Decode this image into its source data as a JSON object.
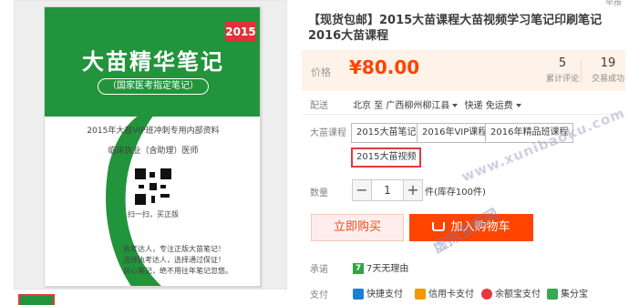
{
  "header": {
    "report_link": "举报"
  },
  "product": {
    "title": "【现货包邮】2015大苗课程大苗视频学习笔记印刷笔记2016大苗课程",
    "cover": {
      "year": "2015",
      "title": "大苗精华笔记",
      "subtitle": "（国家医考指定笔记）",
      "line1": "2015年大苗VIP班冲刺专用内部资料",
      "line2": "临床执业（含助理）医师",
      "scan_text": "扫一扫，买正版",
      "slogans": [
        "执考达人，专注正版大苗笔记！",
        "选择执考达人，选择通过保证！",
        "良心笔记，绝不用往年笔记忽悠。"
      ]
    }
  },
  "price": {
    "label": "价格",
    "value": "¥80.00"
  },
  "stats": [
    {
      "num": "5",
      "label": "累计评论"
    },
    {
      "num": "19",
      "label": "交易成功"
    }
  ],
  "shipping": {
    "label": "配送",
    "from": "北京 至",
    "to": "广西柳州柳江县",
    "method": "快递 免运费"
  },
  "course": {
    "label": "大苗课程",
    "options": [
      "2015大苗笔记",
      "2016年VIP课程",
      "2016年精品班课程",
      "2015大苗视频"
    ]
  },
  "quantity": {
    "label": "数量",
    "value": "1",
    "minus": "−",
    "plus": "+",
    "stock": "件(库存100件)"
  },
  "actions": {
    "buy": "立即购买",
    "cart": "加入购物车"
  },
  "promise": {
    "label": "承诺",
    "seven_icon": "7",
    "text": "7天无理由"
  },
  "payment": {
    "label": "支付",
    "methods": [
      {
        "name": "快捷支付",
        "color": "#1a7dd8"
      },
      {
        "name": "信用卡支付",
        "color": "#f39800"
      },
      {
        "name": "余额宝支付",
        "color": "#e4393c"
      },
      {
        "name": "集分宝",
        "color": "#34a853"
      }
    ]
  },
  "watermark": {
    "text1": "www.xunibaoku.com",
    "text2": "虚拟宝库网"
  },
  "colors": {
    "accent": "#ff4400",
    "price": "#ff4400",
    "green_cover": "#22943b",
    "selected_border": "#e4393c"
  }
}
